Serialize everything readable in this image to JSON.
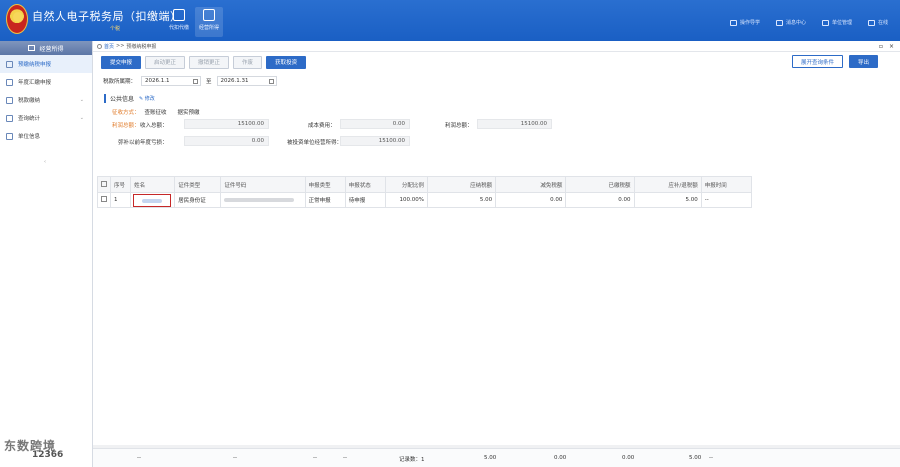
{
  "app": {
    "title": "自然人电子税务局（扣缴端）",
    "subtitle": "个税"
  },
  "topnav": [
    {
      "label": "代扣代缴"
    },
    {
      "label": "经营所得"
    }
  ],
  "topright": [
    "操作导学",
    "消息中心",
    "单位管理",
    "在线"
  ],
  "sidebar": {
    "header": "经营所得",
    "items": [
      {
        "label": "预缴纳税申报"
      },
      {
        "label": "年度汇缴申报"
      },
      {
        "label": "税款缴纳"
      },
      {
        "label": "查询统计"
      },
      {
        "label": "单位信息"
      }
    ]
  },
  "breadcrumb": {
    "home": "首页",
    "sep": ">>",
    "current": "预缴纳税申报"
  },
  "toolbar": {
    "submit": "提交申报",
    "correct": "启动更正",
    "undo_correct": "撤销更正",
    "void": "作废",
    "get_data": "获取投资",
    "open_attach": "展开查询条件",
    "export": "导出"
  },
  "period": {
    "label": "税款所属期：",
    "start": "2026.1.1",
    "sep": "至",
    "end": "2026.1.31"
  },
  "public_info": {
    "title": "公共信息",
    "edit": "修改",
    "levy_label": "征收方式：",
    "levy_value": "查账征收",
    "levy_type": "据实预缴",
    "profit_label": "利润总额：",
    "income_label": "收入总额：",
    "income_value": "15100.00",
    "cost_label": "成本费用：",
    "cost_value": "0.00",
    "profit_total_label": "利润总额：",
    "profit_total_value": "15100.00",
    "loss_label": "弥补以前年度亏损：",
    "loss_value": "0.00",
    "invest_label": "被投资单位经营所得：",
    "invest_value": "15100.00"
  },
  "table": {
    "columns": [
      "序号",
      "姓名",
      "证件类型",
      "证件号码",
      "申报类型",
      "申报状态",
      "分配比例",
      "应纳税额",
      "减免税额",
      "已缴税额",
      "应补/退税额",
      "申报时间"
    ],
    "rows": [
      {
        "index": "1",
        "id_type": "居民身份证",
        "decl_type": "正常申报",
        "status": "待申报",
        "ratio": "100.00%",
        "tax_due": "5.00",
        "relief": "0.00",
        "paid": "0.00",
        "refund": "5.00",
        "time": "--"
      }
    ]
  },
  "footer": {
    "dash1": "--",
    "dash2": "--",
    "dash3": "--",
    "dash4": "--",
    "count_label": "记录数：1",
    "tax_due": "5.00",
    "relief": "0.00",
    "paid": "0.00",
    "refund": "5.00",
    "dash5": "--"
  },
  "watermark": {
    "text": "东数跨境",
    "sub": "12366"
  }
}
